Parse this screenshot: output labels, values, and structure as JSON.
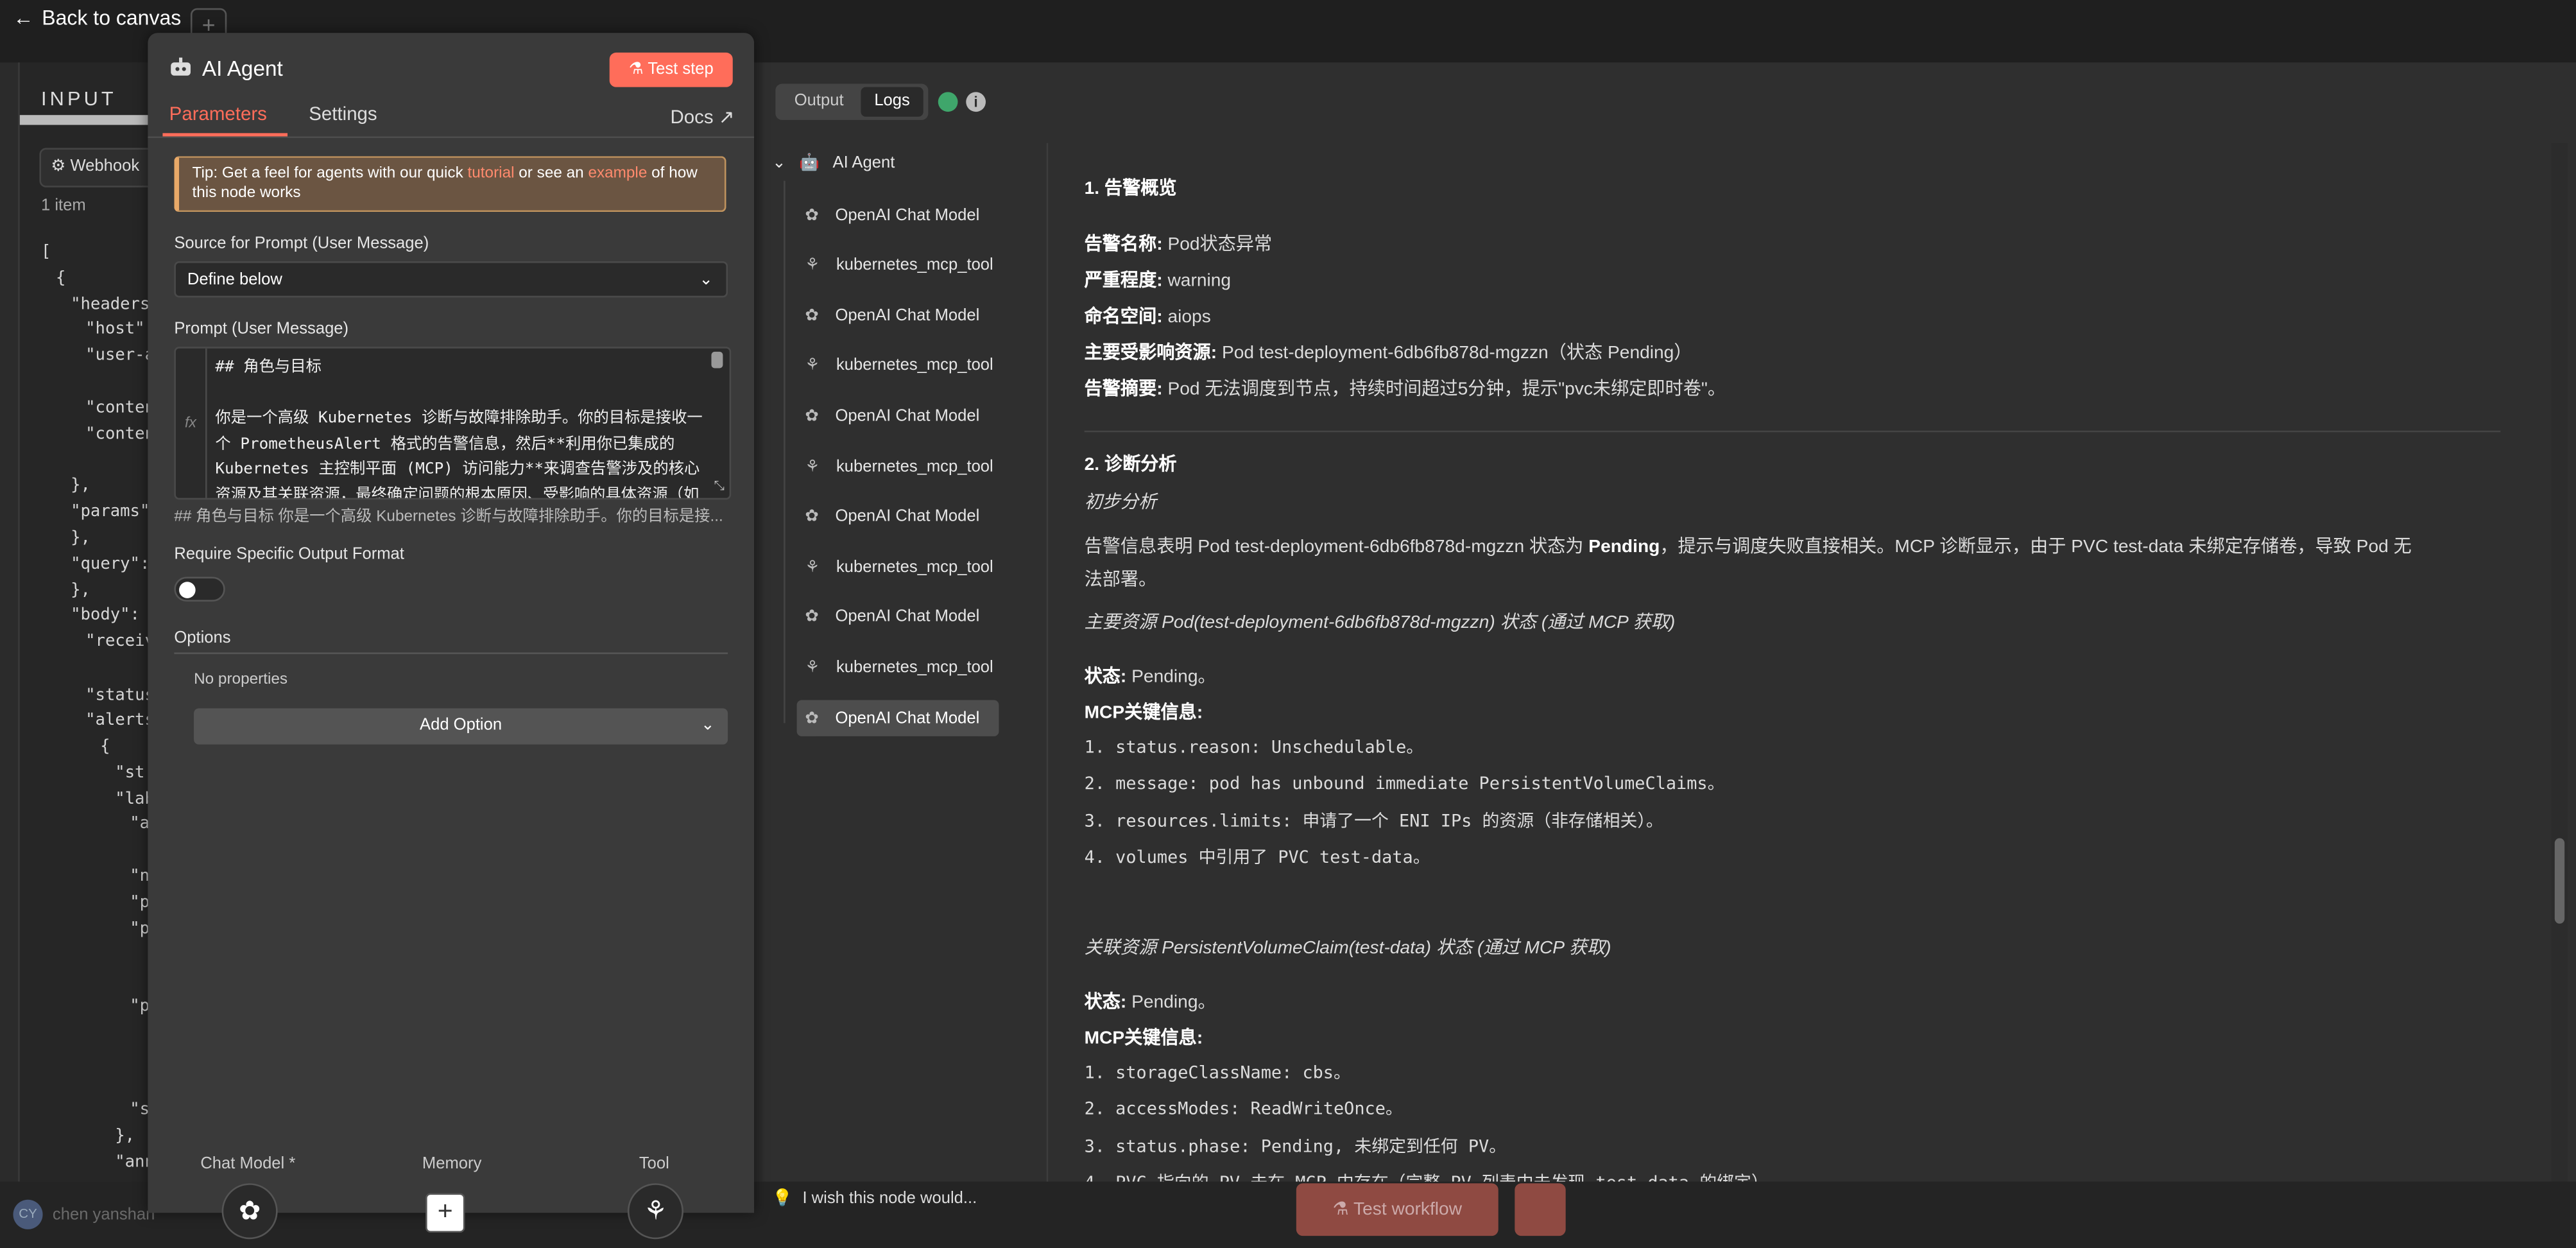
{
  "topbar": {
    "back_label": "Back to canvas",
    "bg_tab": "nan"
  },
  "input_panel": {
    "title": "INPUT",
    "webhook_label": "Webhook",
    "items_count": "1 item",
    "json_lines": [
      "[",
      "{",
      "\"headers\"",
      "\"host\":",
      "\"user-a",
      "\"conten",
      "\"conten",
      "},",
      "\"params\"",
      "},",
      "\"query\":",
      "},",
      "\"body\":",
      "\"receiv",
      "\"status",
      "\"alerts",
      "{",
      "\"st",
      "\"lab",
      "\"a",
      "\"n",
      "\"p",
      "\"p",
      "\"p",
      "\"s",
      "},",
      "\"ann"
    ]
  },
  "agent": {
    "title": "AI Agent",
    "test_step": "Test step",
    "tabs": {
      "parameters": "Parameters",
      "settings": "Settings",
      "docs": "Docs"
    },
    "tip": {
      "prefix": "Tip: Get a feel for agents with our quick ",
      "link1": "tutorial",
      "mid": " or see an ",
      "link2": "example",
      "suffix": " of how this node works"
    },
    "source_label": "Source for Prompt (User Message)",
    "source_value": "Define below",
    "prompt_label": "Prompt (User Message)",
    "prompt_fx": "fx",
    "prompt_text": "## 角色与目标\n\n你是一个高级 Kubernetes 诊断与故障排除助手。你的目标是接收一个 PrometheusAlert 格式的告警信息，然后**利用你已集成的 Kubernetes 主控制平面 (MCP) 访问能力**来调查告警涉及的核心资源及其关联资源，最终确定问题的根本原因、受影响的具体资源（如 Po",
    "prompt_preview": "## 角色与目标 你是一个高级 Kubernetes 诊断与故障排除助手。你的目标是接...",
    "require_label": "Require Specific Output Format",
    "options_label": "Options",
    "no_properties": "No properties",
    "add_option": "Add Option",
    "slots": {
      "chat_model": "Chat Model *",
      "memory": "Memory",
      "tool": "Tool"
    }
  },
  "bottom": {
    "user_name": "chen yanshan",
    "user_initials": "CY",
    "wish": "I wish this node would...",
    "test_workflow": "Test workflow"
  },
  "output": {
    "seg_output": "Output",
    "seg_logs": "Logs",
    "tree_root": "AI Agent",
    "tree_items": [
      "OpenAI Chat Model",
      "kubernetes_mcp_tool",
      "OpenAI Chat Model",
      "kubernetes_mcp_tool",
      "OpenAI Chat Model",
      "kubernetes_mcp_tool",
      "OpenAI Chat Model",
      "kubernetes_mcp_tool",
      "OpenAI Chat Model",
      "kubernetes_mcp_tool",
      "OpenAI Chat Model"
    ],
    "sec1_title": "1. 告警概览",
    "sec1_items": [
      {
        "k": "告警名称:",
        "v": " Pod状态异常"
      },
      {
        "k": "严重程度:",
        "v": " warning"
      },
      {
        "k": "命名空间:",
        "v": " aiops"
      },
      {
        "k": "主要受影响资源:",
        "v": " Pod test-deployment-6db6fb878d-mgzzn（状态 Pending）"
      },
      {
        "k": "告警摘要:",
        "v": " Pod 无法调度到节点，持续时间超过5分钟，提示\"pvc未绑定即时卷\"。"
      }
    ],
    "sec2_title": "2. 诊断分析",
    "sec2_sub": "初步分析",
    "sec2_para_a": "告警信息表明 Pod test-deployment-6db6fb878d-mgzzn 状态为 ",
    "sec2_para_bold": "Pending",
    "sec2_para_b": "，提示与调度失败直接相关。MCP 诊断显示，由于 PVC test-data 未绑定存储卷，导致 Pod 无",
    "sec2_para_c": "法部署。",
    "pod_heading": "主要资源 Pod(test-deployment-6db6fb878d-mgzzn) 状态 (通过 MCP 获取)",
    "pod_status_k": "状态:",
    "pod_status_v": " Pending。",
    "pod_mcp": "MCP关键信息:",
    "pod_list": [
      "status.reason: Unschedulable。",
      "message: pod has unbound immediate PersistentVolumeClaims。",
      "resources.limits: 申请了一个 ENI IPs 的资源（非存储相关）。",
      "volumes 中引用了 PVC test-data。"
    ],
    "pvc_heading": "关联资源 PersistentVolumeClaim(test-data) 状态 (通过 MCP 获取)",
    "pvc_status_k": "状态:",
    "pvc_status_v": " Pending。",
    "pvc_mcp": "MCP关键信息:",
    "pvc_list": [
      "storageClassName: cbs。",
      "accessModes: ReadWriteOnce。",
      "status.phase: Pending, 未绑定到任何 PV。",
      "PVC 指向的 PV 未在 MCP 中存在（完整 PV 列表中未发现 test-data 的绑定）"
    ]
  }
}
